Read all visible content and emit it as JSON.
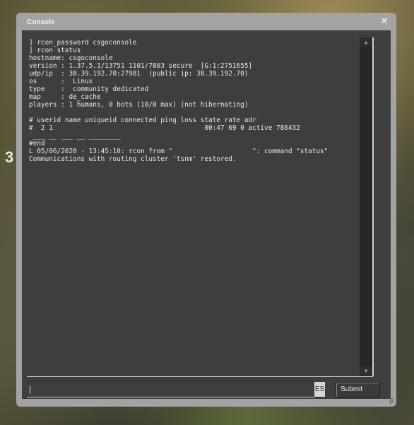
{
  "background": {
    "hud_number": "3"
  },
  "window": {
    "title": "Console",
    "close_icon": "close-icon"
  },
  "console": {
    "lines": [
      "] rcon_password csgoconsole",
      "] rcon status",
      "hostname: csgoconsole",
      "version : 1.37.5.1/13751 1101/7803 secure  [G:1:2751655]",
      "udp/ip  : 38.39.192.70:27981  (public ip: 38.39.192.70)",
      "os      :  Linux",
      "type    :  community dedicated",
      "map     : de_cache",
      "players : 1 humans, 0 bots (10/0 max) (not hibernating)",
      "",
      "# userid name uniqueid connected ping loss state rate adr",
      "#  2 1                                      00:47 69 0 active 786432",
      "˙___ __ ___ __ ________",
      "#end",
      "L 05/06/2020 - 13:45:10: rcon from \"                    \": command \"status\"",
      "Communications with routing cluster 'tsnm' restored."
    ],
    "scroll_up_icon": "triangle-up",
    "scroll_down_icon": "triangle-down"
  },
  "input": {
    "value": "",
    "placeholder": "",
    "language_indicator": "ES"
  },
  "buttons": {
    "submit_label": "Submit"
  }
}
